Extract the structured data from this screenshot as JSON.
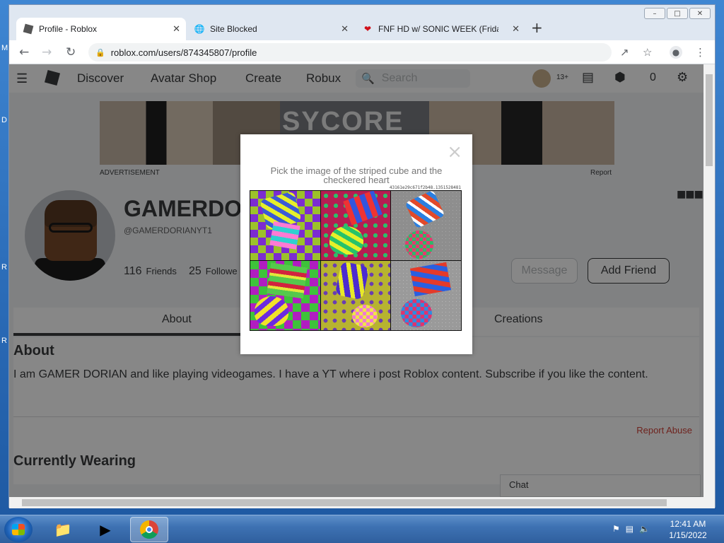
{
  "browser": {
    "tabs": [
      {
        "title": "Profile - Roblox"
      },
      {
        "title": "Site Blocked"
      },
      {
        "title": "FNF HD w/ SONIC WEEK (Friday"
      }
    ],
    "url": "roblox.com/users/874345807/profile"
  },
  "roblox_nav": {
    "items": [
      "Discover",
      "Avatar Shop",
      "Create",
      "Robux"
    ],
    "search_placeholder": "Search",
    "age_badge": "13+",
    "robux_count": "0"
  },
  "ad": {
    "banner_text": "SYCORE",
    "label": "ADVERTISEMENT",
    "report": "Report"
  },
  "profile": {
    "username": "GAMERDO",
    "handle": "@GAMERDORIANYT1",
    "friends_count": "116",
    "friends_label": "Friends",
    "followers_count": "25",
    "followers_label": "Followe",
    "message_button": "Message",
    "add_friend_button": "Add Friend"
  },
  "profile_tabs": {
    "about": "About",
    "creations": "Creations"
  },
  "about": {
    "heading": "About",
    "bio": "I am GAMER DORIAN and like playing videogames. I have a YT where i post Roblox content. Subscribe if you like the content.",
    "report_abuse": "Report Abuse",
    "currently_wearing": "Currently Wearing"
  },
  "chat": {
    "label": "Chat"
  },
  "captcha": {
    "prompt": "Pick the image of the striped cube and the checkered heart",
    "challenge_id": "43161e29c671f2b48.1351528481",
    "close": "×"
  },
  "taskbar": {
    "time": "12:41 AM",
    "date": "1/15/2022"
  },
  "desktop": {
    "edge_chars": [
      "M",
      "D",
      "R",
      "R"
    ]
  }
}
